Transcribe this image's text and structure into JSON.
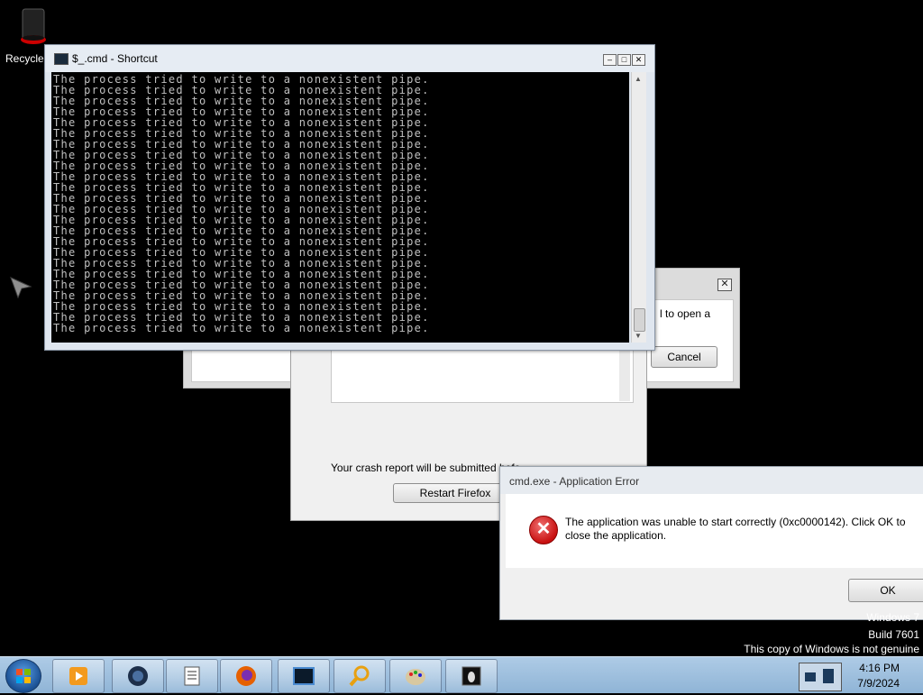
{
  "desktop": {
    "recycle_label": "Recycle"
  },
  "back_dialog": {
    "partial_text": "l to open a",
    "cancel_label": "Cancel"
  },
  "firefox_crash": {
    "report_text": "Your crash report will be submitted befo",
    "restart_label": "Restart Firefox"
  },
  "cmd_window": {
    "title": "$_.cmd - Shortcut",
    "lines": [
      "The process tried to write to a nonexistent pipe.",
      "The process tried to write to a nonexistent pipe.",
      "The process tried to write to a nonexistent pipe.",
      "The process tried to write to a nonexistent pipe.",
      "The process tried to write to a nonexistent pipe.",
      "The process tried to write to a nonexistent pipe.",
      "The process tried to write to a nonexistent pipe.",
      "The process tried to write to a nonexistent pipe.",
      "The process tried to write to a nonexistent pipe.",
      "The process tried to write to a nonexistent pipe.",
      "The process tried to write to a nonexistent pipe.",
      "The process tried to write to a nonexistent pipe.",
      "The process tried to write to a nonexistent pipe.",
      "The process tried to write to a nonexistent pipe.",
      "The process tried to write to a nonexistent pipe.",
      "The process tried to write to a nonexistent pipe.",
      "The process tried to write to a nonexistent pipe.",
      "The process tried to write to a nonexistent pipe.",
      "The process tried to write to a nonexistent pipe.",
      "The process tried to write to a nonexistent pipe.",
      "The process tried to write to a nonexistent pipe.",
      "The process tried to write to a nonexistent pipe.",
      "The process tried to write to a nonexistent pipe.",
      "The process tried to write to a nonexistent pipe."
    ]
  },
  "error_dialog": {
    "title": "cmd.exe - Application Error",
    "message": "The application was unable to start correctly (0xc0000142). Click OK to close the application.",
    "ok_label": "OK"
  },
  "watermark": {
    "line1": "Windows 7",
    "line2": "Build 7601",
    "line3": "This copy of Windows is not genuine"
  },
  "taskbar": {
    "time": "4:16 PM",
    "date": "7/9/2024",
    "pinned": [
      "media-player-icon",
      "globe-icon",
      "notepad-icon",
      "firefox-icon",
      "cmd-icon",
      "search-icon",
      "paint-icon",
      "bug-icon"
    ]
  }
}
